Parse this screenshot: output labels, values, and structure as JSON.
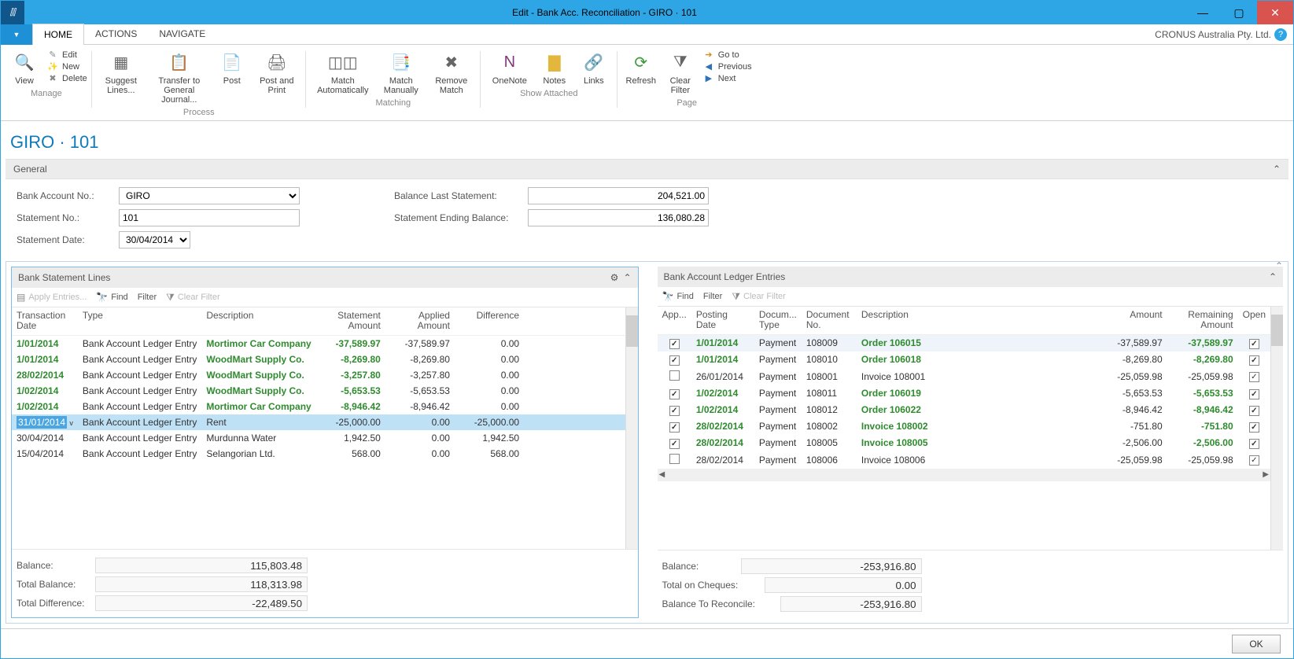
{
  "window_title": "Edit - Bank Acc. Reconciliation - GIRO · 101",
  "company": "CRONUS Australia Pty. Ltd.",
  "menu_tabs": [
    "HOME",
    "ACTIONS",
    "NAVIGATE"
  ],
  "ribbon": {
    "manage": {
      "label": "Manage",
      "view": "View",
      "edit": "Edit",
      "new": "New",
      "delete": "Delete"
    },
    "process": {
      "label": "Process",
      "suggest": "Suggest Lines...",
      "transfer": "Transfer to General Journal...",
      "post": "Post",
      "postprint": "Post and Print"
    },
    "matching": {
      "label": "Matching",
      "auto": "Match Automatically",
      "manual": "Match Manually",
      "remove": "Remove Match"
    },
    "showattached": {
      "label": "Show Attached",
      "onenote": "OneNote",
      "notes": "Notes",
      "links": "Links"
    },
    "page": {
      "label": "Page",
      "refresh": "Refresh",
      "clear": "Clear Filter",
      "goto": "Go to",
      "prev": "Previous",
      "next": "Next"
    }
  },
  "page_title": "GIRO · 101",
  "general": {
    "header": "General",
    "bank_label": "Bank Account No.:",
    "bank_value": "GIRO",
    "stmt_label": "Statement No.:",
    "stmt_value": "101",
    "date_label": "Statement Date:",
    "date_value": "30/04/2014",
    "ballast_label": "Balance Last Statement:",
    "ballast_value": "204,521.00",
    "ending_label": "Statement Ending Balance:",
    "ending_value": "136,080.28"
  },
  "left": {
    "title": "Bank Statement Lines",
    "toolbar": {
      "apply": "Apply Entries...",
      "find": "Find",
      "filter": "Filter",
      "clear": "Clear Filter"
    },
    "cols": {
      "trans": "Transaction Date",
      "type": "Type",
      "desc": "Description",
      "samt": "Statement Amount",
      "aamt": "Applied Amount",
      "diff": "Difference"
    },
    "rows": [
      {
        "date": "1/01/2014",
        "type": "Bank Account Ledger Entry",
        "desc": "Mortimor Car Company",
        "samt": "-37,589.97",
        "aamt": "-37,589.97",
        "diff": "0.00",
        "matched": true
      },
      {
        "date": "1/01/2014",
        "type": "Bank Account Ledger Entry",
        "desc": "WoodMart Supply Co.",
        "samt": "-8,269.80",
        "aamt": "-8,269.80",
        "diff": "0.00",
        "matched": true
      },
      {
        "date": "28/02/2014",
        "type": "Bank Account Ledger Entry",
        "desc": "WoodMart Supply Co.",
        "samt": "-3,257.80",
        "aamt": "-3,257.80",
        "diff": "0.00",
        "matched": true
      },
      {
        "date": "1/02/2014",
        "type": "Bank Account Ledger Entry",
        "desc": "WoodMart Supply Co.",
        "samt": "-5,653.53",
        "aamt": "-5,653.53",
        "diff": "0.00",
        "matched": true
      },
      {
        "date": "1/02/2014",
        "type": "Bank Account Ledger Entry",
        "desc": "Mortimor Car Company",
        "samt": "-8,946.42",
        "aamt": "-8,946.42",
        "diff": "0.00",
        "matched": true
      },
      {
        "date": "31/01/2014",
        "type": "Bank Account Ledger Entry",
        "desc": "Rent",
        "samt": "-25,000.00",
        "aamt": "0.00",
        "diff": "-25,000.00",
        "matched": false,
        "selected": true
      },
      {
        "date": "30/04/2014",
        "type": "Bank Account Ledger Entry",
        "desc": "Murdunna Water",
        "samt": "1,942.50",
        "aamt": "0.00",
        "diff": "1,942.50",
        "matched": false
      },
      {
        "date": "15/04/2014",
        "type": "Bank Account Ledger Entry",
        "desc": "Selangorian Ltd.",
        "samt": "568.00",
        "aamt": "0.00",
        "diff": "568.00",
        "matched": false
      }
    ],
    "footer": {
      "balance_label": "Balance:",
      "balance": "115,803.48",
      "total_label": "Total Balance:",
      "total": "118,313.98",
      "diff_label": "Total Difference:",
      "diff": "-22,489.50"
    }
  },
  "right": {
    "title": "Bank Account Ledger Entries",
    "toolbar": {
      "find": "Find",
      "filter": "Filter",
      "clear": "Clear Filter"
    },
    "cols": {
      "app": "App...",
      "pdate": "Posting Date",
      "dtype": "Docum... Type",
      "dno": "Document No.",
      "desc": "Description",
      "amt": "Amount",
      "rem": "Remaining Amount",
      "open": "Open"
    },
    "rows": [
      {
        "app": true,
        "pdate": "1/01/2014",
        "dtype": "Payment",
        "dno": "108009",
        "desc": "Order 106015",
        "amt": "-37,589.97",
        "rem": "-37,589.97",
        "open": true,
        "matched": true,
        "hl": true
      },
      {
        "app": true,
        "pdate": "1/01/2014",
        "dtype": "Payment",
        "dno": "108010",
        "desc": "Order 106018",
        "amt": "-8,269.80",
        "rem": "-8,269.80",
        "open": true,
        "matched": true
      },
      {
        "app": false,
        "pdate": "26/01/2014",
        "dtype": "Payment",
        "dno": "108001",
        "desc": "Invoice 108001",
        "amt": "-25,059.98",
        "rem": "-25,059.98",
        "open": true,
        "matched": false
      },
      {
        "app": true,
        "pdate": "1/02/2014",
        "dtype": "Payment",
        "dno": "108011",
        "desc": "Order 106019",
        "amt": "-5,653.53",
        "rem": "-5,653.53",
        "open": true,
        "matched": true
      },
      {
        "app": true,
        "pdate": "1/02/2014",
        "dtype": "Payment",
        "dno": "108012",
        "desc": "Order 106022",
        "amt": "-8,946.42",
        "rem": "-8,946.42",
        "open": true,
        "matched": true
      },
      {
        "app": true,
        "pdate": "28/02/2014",
        "dtype": "Payment",
        "dno": "108002",
        "desc": "Invoice 108002",
        "amt": "-751.80",
        "rem": "-751.80",
        "open": true,
        "matched": true
      },
      {
        "app": true,
        "pdate": "28/02/2014",
        "dtype": "Payment",
        "dno": "108005",
        "desc": "Invoice 108005",
        "amt": "-2,506.00",
        "rem": "-2,506.00",
        "open": true,
        "matched": true
      },
      {
        "app": false,
        "pdate": "28/02/2014",
        "dtype": "Payment",
        "dno": "108006",
        "desc": "Invoice 108006",
        "amt": "-25,059.98",
        "rem": "-25,059.98",
        "open": true,
        "matched": false
      }
    ],
    "footer": {
      "balance_label": "Balance:",
      "balance": "-253,916.80",
      "cheq_label": "Total on Cheques:",
      "cheq": "0.00",
      "recon_label": "Balance To Reconcile:",
      "recon": "-253,916.80"
    }
  },
  "ok": "OK"
}
